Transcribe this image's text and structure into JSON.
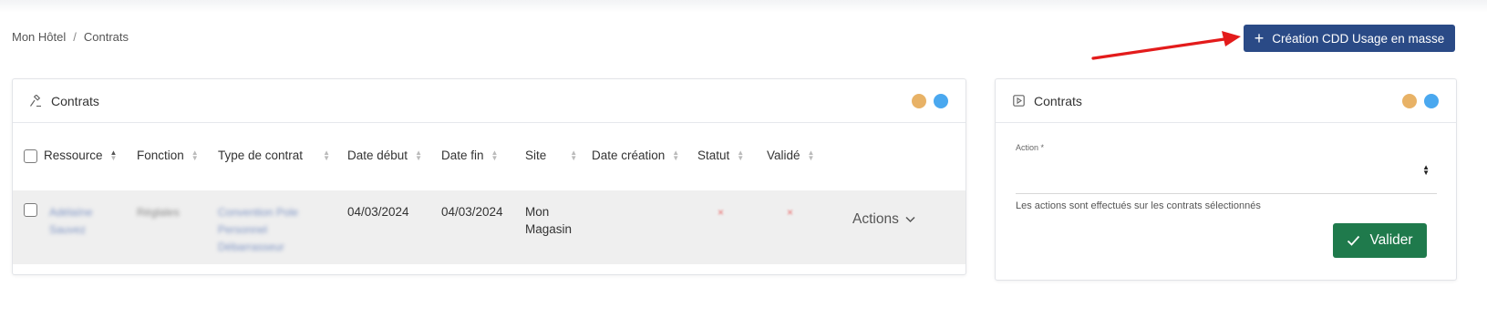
{
  "breadcrumb": {
    "home": "Mon Hôtel",
    "separator": "/",
    "current": "Contrats"
  },
  "header": {
    "mass_button_label": "Création CDD Usage en masse",
    "mass_button_icon": "plus-icon",
    "arrow_color": "#e31b1b",
    "button_color": "#2a4a86"
  },
  "contracts_panel": {
    "title": "Contrats",
    "icon": "gavel-icon",
    "dot_colors": [
      "#e8b266",
      "#4aa8ef"
    ],
    "columns": [
      "Ressource",
      "Fonction",
      "Type de contrat",
      "Date début",
      "Date fin",
      "Site",
      "Date création",
      "Statut",
      "Validé"
    ],
    "rows": [
      {
        "ressource": "Adélaïne Sauvez",
        "fonction": "Réglales",
        "type_contrat": "Convention Pole Personnel Débarrasseur",
        "date_debut": "04/03/2024",
        "date_fin": "04/03/2024",
        "site": "Mon Magasin",
        "date_creation": "",
        "statut": "×",
        "valide": "×",
        "actions_label": "Actions"
      }
    ]
  },
  "actions_panel": {
    "title": "Contrats",
    "icon": "play-square-icon",
    "dot_colors": [
      "#e8b266",
      "#4aa8ef"
    ],
    "action_label": "Action *",
    "action_value": "",
    "help_text": "Les actions sont effectués sur les contrats sélectionnés",
    "submit_label": "Valider",
    "submit_color": "#1f7a4c"
  }
}
